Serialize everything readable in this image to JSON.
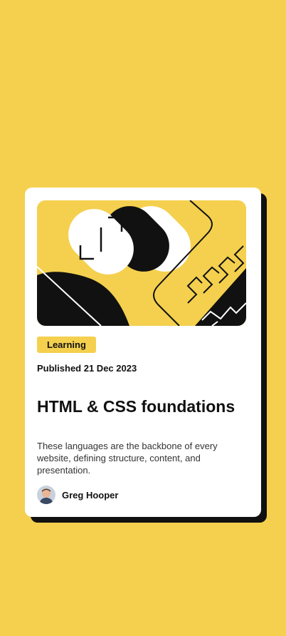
{
  "card": {
    "tag": "Learning",
    "published": "Published 21 Dec 2023",
    "title": "HTML & CSS foundations",
    "description": "These languages are the backbone of every website, defining structure, content, and presentation.",
    "author": "Greg Hooper"
  },
  "colors": {
    "background": "#F4D04E",
    "card": "#FFFFFF",
    "shadow": "#111111",
    "text": "#111111"
  }
}
